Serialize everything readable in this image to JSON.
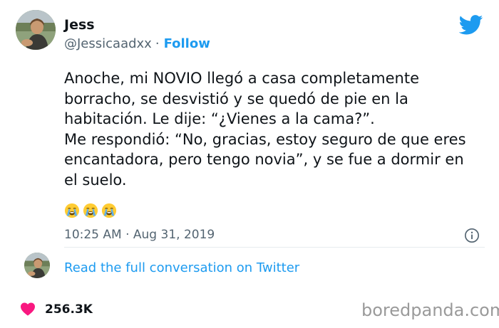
{
  "user": {
    "name": "Jess",
    "handle": "@Jessicaadxx",
    "separator": "·",
    "follow_label": "Follow"
  },
  "brand_icon": "twitter-bird-icon",
  "tweet": {
    "paragraphs": [
      "Anoche, mi NOVIO llegó a casa completamente borracho, se desvistió y se quedó de pie en la habitación. Le dije: “¿Vienes a la cama?”.",
      "Me respondió: “No, gracias, estoy seguro de que eres encantadora, pero tengo novia”, y se fue a dormir en el suelo."
    ],
    "emojis": [
      "loudly-crying-face",
      "loudly-crying-face",
      "loudly-crying-face"
    ],
    "timestamp": "10:25 AM · Aug 31, 2019"
  },
  "conversation_link": "Read the full conversation on Twitter",
  "likes_count": "256.3K",
  "watermark": "boredpanda.com",
  "colors": {
    "accent": "#1d9bf0",
    "text": "#0f1419",
    "muted": "#536471",
    "heart": "#f91880"
  }
}
